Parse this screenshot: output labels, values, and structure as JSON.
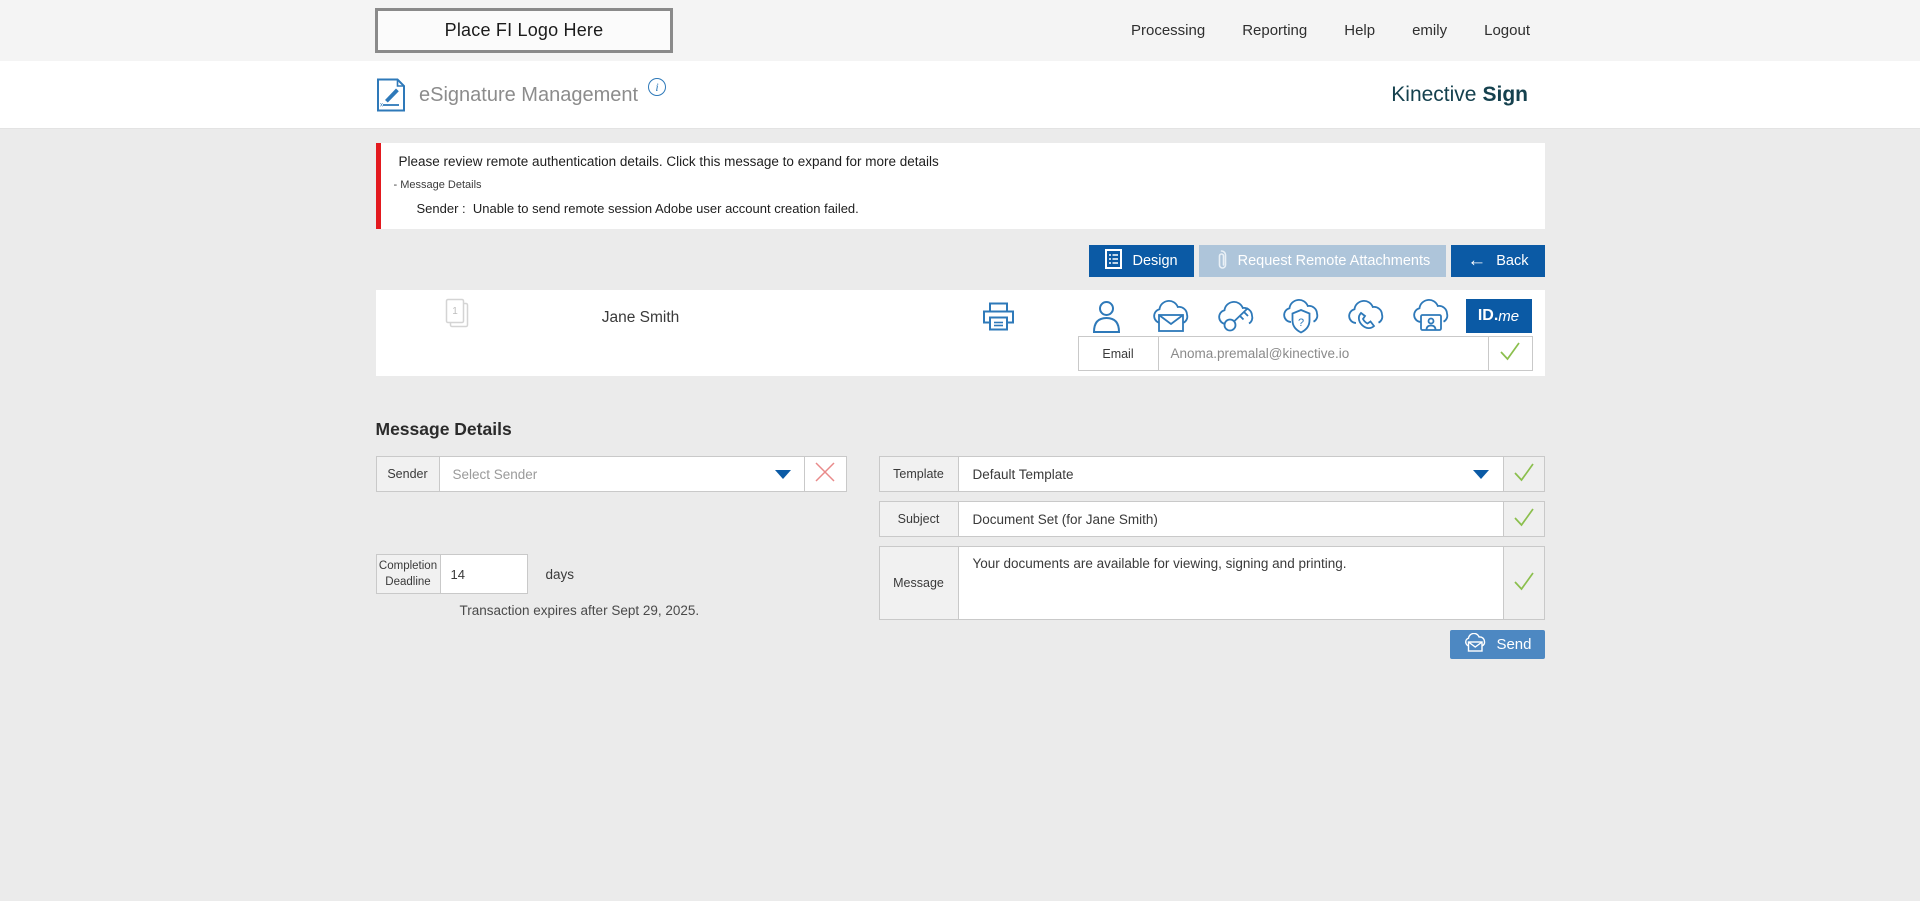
{
  "topbar": {
    "logo_placeholder": "Place FI Logo Here",
    "nav": [
      {
        "label": "Processing"
      },
      {
        "label": "Reporting"
      },
      {
        "label": "Help"
      },
      {
        "label": "emily"
      },
      {
        "label": "Logout"
      }
    ]
  },
  "header": {
    "title": "eSignature Management",
    "info": "i",
    "brand_name": "Kinective",
    "brand_product": "Sign"
  },
  "alert": {
    "line1": "Please review remote authentication details. Click this message to expand for more details",
    "line2": "- Message Details",
    "line3": "Sender :  Unable to send remote session Adobe user account creation failed."
  },
  "toolbar": {
    "design_label": "Design",
    "request_remote_label": "Request Remote Attachments",
    "back_label": "Back",
    "back_arrow": "←"
  },
  "recipient": {
    "doc_count": "1",
    "name": "Jane Smith",
    "idme_bold": "ID.",
    "idme_italic": "me",
    "email_label": "Email",
    "email_value": "Anoma.premalal@kinective.io"
  },
  "message_details": {
    "heading": "Message Details",
    "sender_label": "Sender",
    "sender_placeholder": "Select Sender",
    "deadline_label": "Completion Deadline",
    "deadline_value": "14",
    "deadline_unit": "days",
    "expires_note": "Transaction expires after Sept 29, 2025.",
    "template_label": "Template",
    "template_value": "Default Template",
    "subject_label": "Subject",
    "subject_value": "Document Set (for Jane Smith)",
    "message_label": "Message",
    "message_value": "Your documents are available for viewing, signing and printing.",
    "send_label": "Send"
  },
  "colors": {
    "primary_blue": "#0b5aa5",
    "disabled_blue": "#aec5da",
    "send_blue": "#4d88c2",
    "icon_blue": "#2e79b9",
    "alert_red": "#e3191e",
    "check_green": "#8bbf4d",
    "brand_teal": "#15414e",
    "topbar_gray": "#f4f4f4",
    "page_gray": "#ebebeb"
  }
}
